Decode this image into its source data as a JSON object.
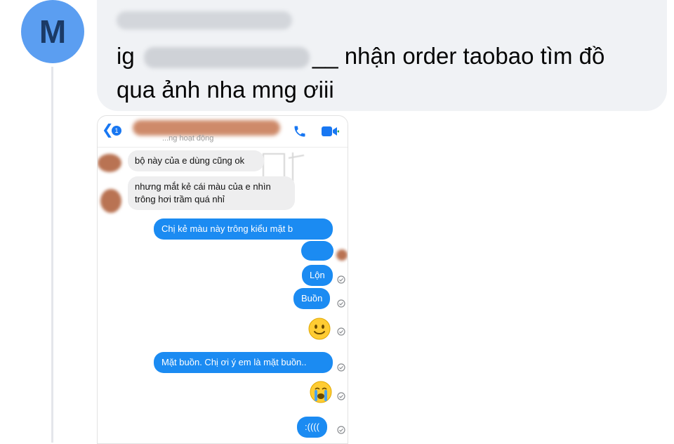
{
  "comment": {
    "avatar_letter": "M",
    "author_name": "■■■ ■■■■ ■■■ ■■■■",
    "prefix": "ig",
    "handle": "■■■■■■■■■■■■■■",
    "text_line1": "__ nhận order taobao tìm đồ",
    "text_line2": "qua ảnh nha mng ơiii"
  },
  "screenshot": {
    "back_count": "1",
    "contact_name": "■■■■■■■■",
    "status": "...ng hoạt động",
    "messages": [
      {
        "id": "m1",
        "dir": "in",
        "text": "bộ này của e dùng cũng ok"
      },
      {
        "id": "m2",
        "dir": "in",
        "text": "nhưng mắt kẻ cái màu của e nhìn trông hơi trầm quá nhỉ"
      },
      {
        "id": "m3",
        "dir": "out",
        "text": "Chị kẻ màu này trông kiểu mặt b"
      },
      {
        "id": "m4",
        "dir": "out",
        "text": ""
      },
      {
        "id": "m5",
        "dir": "out",
        "text": "Lộn"
      },
      {
        "id": "m6",
        "dir": "out",
        "text": "Buồn"
      },
      {
        "id": "m7",
        "dir": "out",
        "text": "🙂"
      },
      {
        "id": "m8",
        "dir": "out",
        "text": "Mặt buồn. Chị ơi ý em là mặt buồn.."
      },
      {
        "id": "m9",
        "dir": "out",
        "text": "😭"
      },
      {
        "id": "m10",
        "dir": "out",
        "text": ":(((("
      }
    ],
    "colors": {
      "outgoing": "#1b8bf2",
      "incoming": "#eeeeef",
      "accent": "#1877f2"
    }
  }
}
